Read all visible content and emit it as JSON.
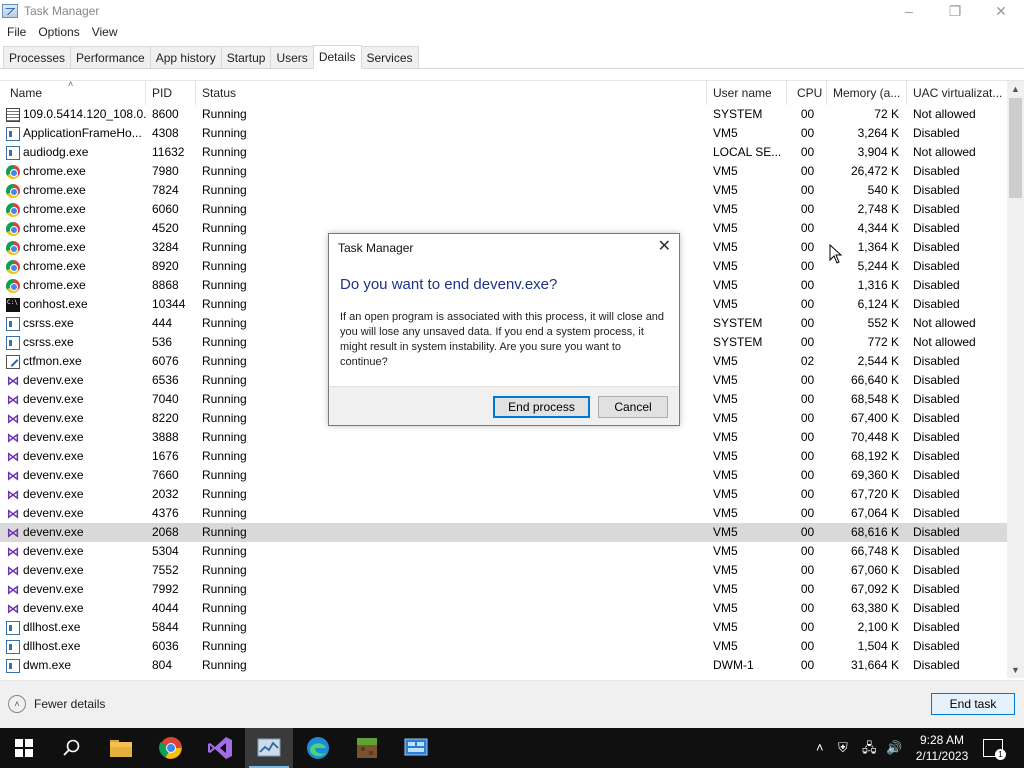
{
  "window": {
    "title": "Task Manager"
  },
  "menu": [
    "File",
    "Options",
    "View"
  ],
  "tabs": [
    "Processes",
    "Performance",
    "App history",
    "Startup",
    "Users",
    "Details",
    "Services"
  ],
  "active_tab": "Details",
  "columns": [
    "Name",
    "PID",
    "Status",
    "User name",
    "CPU",
    "Memory (a...",
    "UAC virtualizat..."
  ],
  "rows": [
    {
      "icon": "gen",
      "name": "109.0.5414.120_108.0....",
      "pid": "8600",
      "status": "Running",
      "user": "SYSTEM",
      "cpu": "00",
      "mem": "72 K",
      "uac": "Not allowed"
    },
    {
      "icon": "app",
      "name": "ApplicationFrameHo...",
      "pid": "4308",
      "status": "Running",
      "user": "VM5",
      "cpu": "00",
      "mem": "3,264 K",
      "uac": "Disabled"
    },
    {
      "icon": "app",
      "name": "audiodg.exe",
      "pid": "11632",
      "status": "Running",
      "user": "LOCAL SE...",
      "cpu": "00",
      "mem": "3,904 K",
      "uac": "Not allowed"
    },
    {
      "icon": "chrome",
      "name": "chrome.exe",
      "pid": "7980",
      "status": "Running",
      "user": "VM5",
      "cpu": "00",
      "mem": "26,472 K",
      "uac": "Disabled"
    },
    {
      "icon": "chrome",
      "name": "chrome.exe",
      "pid": "7824",
      "status": "Running",
      "user": "VM5",
      "cpu": "00",
      "mem": "540 K",
      "uac": "Disabled"
    },
    {
      "icon": "chrome",
      "name": "chrome.exe",
      "pid": "6060",
      "status": "Running",
      "user": "VM5",
      "cpu": "00",
      "mem": "2,748 K",
      "uac": "Disabled"
    },
    {
      "icon": "chrome",
      "name": "chrome.exe",
      "pid": "4520",
      "status": "Running",
      "user": "VM5",
      "cpu": "00",
      "mem": "4,344 K",
      "uac": "Disabled"
    },
    {
      "icon": "chrome",
      "name": "chrome.exe",
      "pid": "3284",
      "status": "Running",
      "user": "VM5",
      "cpu": "00",
      "mem": "1,364 K",
      "uac": "Disabled"
    },
    {
      "icon": "chrome",
      "name": "chrome.exe",
      "pid": "8920",
      "status": "Running",
      "user": "VM5",
      "cpu": "00",
      "mem": "5,244 K",
      "uac": "Disabled"
    },
    {
      "icon": "chrome",
      "name": "chrome.exe",
      "pid": "8868",
      "status": "Running",
      "user": "VM5",
      "cpu": "00",
      "mem": "1,316 K",
      "uac": "Disabled"
    },
    {
      "icon": "cmd",
      "name": "conhost.exe",
      "pid": "10344",
      "status": "Running",
      "user": "VM5",
      "cpu": "00",
      "mem": "6,124 K",
      "uac": "Disabled"
    },
    {
      "icon": "app",
      "name": "csrss.exe",
      "pid": "444",
      "status": "Running",
      "user": "SYSTEM",
      "cpu": "00",
      "mem": "552 K",
      "uac": "Not allowed"
    },
    {
      "icon": "app",
      "name": "csrss.exe",
      "pid": "536",
      "status": "Running",
      "user": "SYSTEM",
      "cpu": "00",
      "mem": "772 K",
      "uac": "Not allowed"
    },
    {
      "icon": "edit",
      "name": "ctfmon.exe",
      "pid": "6076",
      "status": "Running",
      "user": "VM5",
      "cpu": "02",
      "mem": "2,544 K",
      "uac": "Disabled"
    },
    {
      "icon": "vs",
      "name": "devenv.exe",
      "pid": "6536",
      "status": "Running",
      "user": "VM5",
      "cpu": "00",
      "mem": "66,640 K",
      "uac": "Disabled"
    },
    {
      "icon": "vs",
      "name": "devenv.exe",
      "pid": "7040",
      "status": "Running",
      "user": "VM5",
      "cpu": "00",
      "mem": "68,548 K",
      "uac": "Disabled"
    },
    {
      "icon": "vs",
      "name": "devenv.exe",
      "pid": "8220",
      "status": "Running",
      "user": "VM5",
      "cpu": "00",
      "mem": "67,400 K",
      "uac": "Disabled"
    },
    {
      "icon": "vs",
      "name": "devenv.exe",
      "pid": "3888",
      "status": "Running",
      "user": "VM5",
      "cpu": "00",
      "mem": "70,448 K",
      "uac": "Disabled"
    },
    {
      "icon": "vs",
      "name": "devenv.exe",
      "pid": "1676",
      "status": "Running",
      "user": "VM5",
      "cpu": "00",
      "mem": "68,192 K",
      "uac": "Disabled"
    },
    {
      "icon": "vs",
      "name": "devenv.exe",
      "pid": "7660",
      "status": "Running",
      "user": "VM5",
      "cpu": "00",
      "mem": "69,360 K",
      "uac": "Disabled"
    },
    {
      "icon": "vs",
      "name": "devenv.exe",
      "pid": "2032",
      "status": "Running",
      "user": "VM5",
      "cpu": "00",
      "mem": "67,720 K",
      "uac": "Disabled"
    },
    {
      "icon": "vs",
      "name": "devenv.exe",
      "pid": "4376",
      "status": "Running",
      "user": "VM5",
      "cpu": "00",
      "mem": "67,064 K",
      "uac": "Disabled"
    },
    {
      "icon": "vs",
      "name": "devenv.exe",
      "pid": "2068",
      "status": "Running",
      "user": "VM5",
      "cpu": "00",
      "mem": "68,616 K",
      "uac": "Disabled",
      "selected": true
    },
    {
      "icon": "vs",
      "name": "devenv.exe",
      "pid": "5304",
      "status": "Running",
      "user": "VM5",
      "cpu": "00",
      "mem": "66,748 K",
      "uac": "Disabled"
    },
    {
      "icon": "vs",
      "name": "devenv.exe",
      "pid": "7552",
      "status": "Running",
      "user": "VM5",
      "cpu": "00",
      "mem": "67,060 K",
      "uac": "Disabled"
    },
    {
      "icon": "vs",
      "name": "devenv.exe",
      "pid": "7992",
      "status": "Running",
      "user": "VM5",
      "cpu": "00",
      "mem": "67,092 K",
      "uac": "Disabled"
    },
    {
      "icon": "vs",
      "name": "devenv.exe",
      "pid": "4044",
      "status": "Running",
      "user": "VM5",
      "cpu": "00",
      "mem": "63,380 K",
      "uac": "Disabled"
    },
    {
      "icon": "app",
      "name": "dllhost.exe",
      "pid": "5844",
      "status": "Running",
      "user": "VM5",
      "cpu": "00",
      "mem": "2,100 K",
      "uac": "Disabled"
    },
    {
      "icon": "app",
      "name": "dllhost.exe",
      "pid": "6036",
      "status": "Running",
      "user": "VM5",
      "cpu": "00",
      "mem": "1,504 K",
      "uac": "Disabled"
    },
    {
      "icon": "app",
      "name": "dwm.exe",
      "pid": "804",
      "status": "Running",
      "user": "DWM-1",
      "cpu": "00",
      "mem": "31,664 K",
      "uac": "Disabled"
    }
  ],
  "footer": {
    "fewer_details": "Fewer details",
    "end_task": "End task"
  },
  "dialog": {
    "title": "Task Manager",
    "heading": "Do you want to end devenv.exe?",
    "body": "If an open program is associated with this process, it will close and you will lose any unsaved data. If you end a system process, it might result in system instability. Are you sure you want to continue?",
    "primary": "End process",
    "secondary": "Cancel"
  },
  "taskbar": {
    "apps": [
      "start-icon",
      "search-icon",
      "file-explorer-icon",
      "chrome-icon",
      "visual-studio-icon",
      "task-manager-icon",
      "edge-icon",
      "minecraft-icon",
      "remote-desktop-icon"
    ],
    "time": "9:28 AM",
    "date": "2/11/2023",
    "notifications": "1"
  },
  "colors": {
    "accent": "#0078d7",
    "dialog_heading": "#1e3287",
    "selected_row": "#d9d9d9",
    "taskbar": "#101010"
  }
}
